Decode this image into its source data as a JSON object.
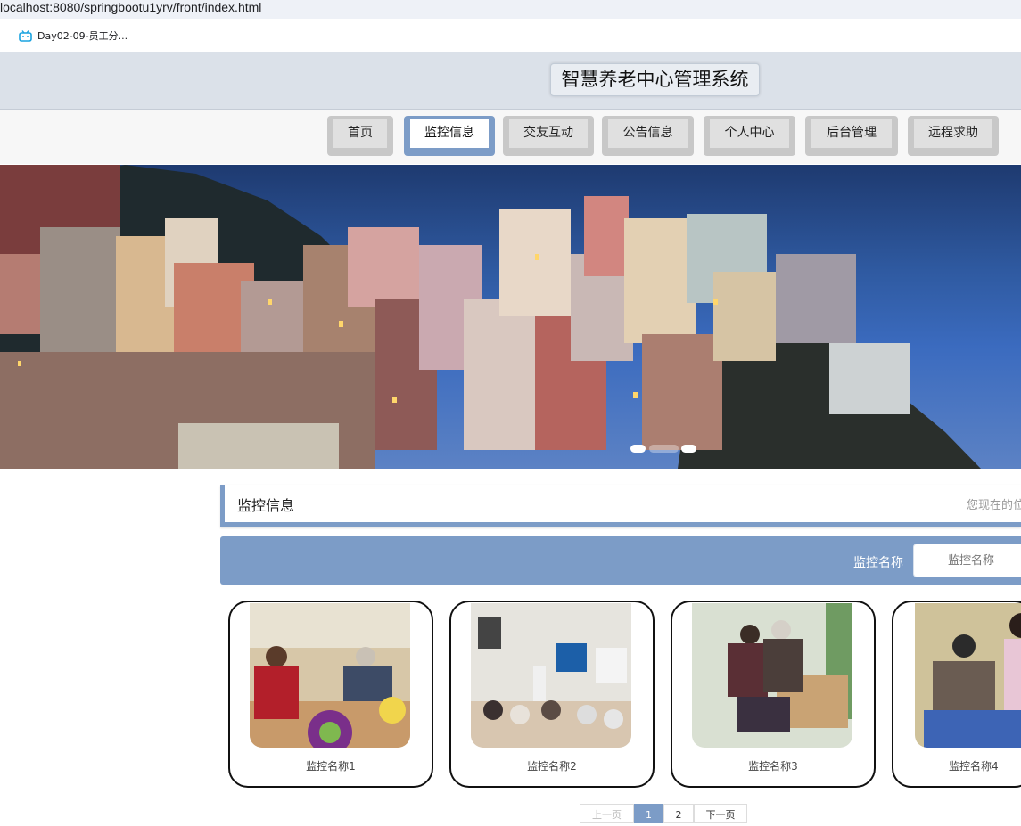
{
  "browser": {
    "url": "localhost:8080/springbootu1yrv/front/index.html",
    "bookmark_label": "Day02-09-员工分..."
  },
  "site": {
    "title": "智慧养老中心管理系统"
  },
  "nav": {
    "items": [
      {
        "label": "首页"
      },
      {
        "label": "监控信息"
      },
      {
        "label": "交友互动"
      },
      {
        "label": "公告信息"
      },
      {
        "label": "个人中心"
      },
      {
        "label": "后台管理"
      },
      {
        "label": "远程求助"
      }
    ],
    "active_index": 1
  },
  "section": {
    "title": "监控信息",
    "location": "您现在的位"
  },
  "search": {
    "label": "监控名称",
    "placeholder": "监控名称"
  },
  "cards": [
    {
      "name": "监控名称1"
    },
    {
      "name": "监控名称2"
    },
    {
      "name": "监控名称3"
    },
    {
      "name": "监控名称4"
    }
  ],
  "pagination": {
    "prev": "上一页",
    "pages": [
      "1",
      "2"
    ],
    "next": "下一页",
    "current": "1"
  },
  "colors": {
    "accent": "#7c9cc7",
    "title_bar": "#dbe1e9"
  }
}
